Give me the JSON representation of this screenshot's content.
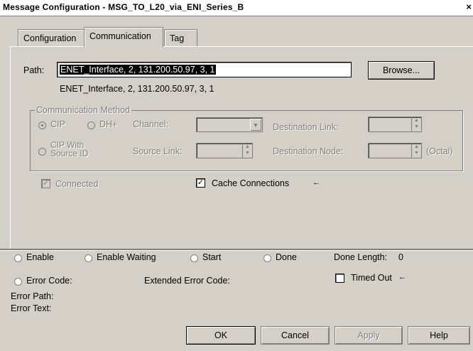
{
  "window": {
    "title": "Message Configuration - MSG_TO_L20_via_ENI_Series_B",
    "close_glyph": "×"
  },
  "tabs": [
    {
      "label": "Configuration",
      "active": false
    },
    {
      "label": "Communication",
      "active": true
    },
    {
      "label": "Tag",
      "active": false
    }
  ],
  "path": {
    "label": "Path:",
    "value": "ENET_Interface, 2, 131.200.50.97, 3, 1",
    "resolved": "ENET_Interface, 2, 131.200.50.97, 3, 1",
    "browse_label": "Browse..."
  },
  "comm_method": {
    "title": "Communication Method",
    "cip_label": "CIP",
    "dhplus_label": "DH+",
    "cip_with_source_line1": "CIP With",
    "cip_with_source_line2": "Source ID",
    "channel_label": "Channel:",
    "dest_link_label": "Destination Link:",
    "source_link_label": "Source Link:",
    "dest_node_label": "Destination Node:",
    "octal_label": "(Octal)"
  },
  "connected": {
    "label": "Connected",
    "checked": true,
    "enabled": false
  },
  "cache": {
    "label": "Cache Connections",
    "checked": true,
    "arrow": "←"
  },
  "status": {
    "enable": "Enable",
    "enable_waiting": "Enable Waiting",
    "start": "Start",
    "done": "Done",
    "done_length_label": "Done Length:",
    "done_length_value": "0",
    "error_code": "Error Code:",
    "extended_error_code": "Extended Error Code:",
    "timed_out": "Timed Out",
    "timed_out_arrow": "←",
    "error_path": "Error Path:",
    "error_text": "Error Text:"
  },
  "buttons": {
    "ok": "OK",
    "cancel": "Cancel",
    "apply": "Apply",
    "help": "Help"
  }
}
